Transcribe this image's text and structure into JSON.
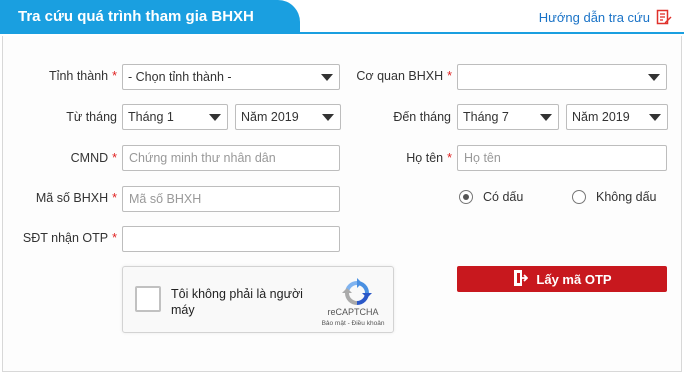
{
  "header": {
    "title": "Tra cứu quá trình tham gia BHXH",
    "guide_label": "Hướng dẫn tra cứu"
  },
  "colors": {
    "brand_blue": "#1a9fe0",
    "button_red": "#c8181e",
    "required": "#e02020"
  },
  "form": {
    "province": {
      "label": "Tỉnh thành",
      "value": "- Chọn tỉnh thành -"
    },
    "agency": {
      "label": "Cơ quan BHXH",
      "value": ""
    },
    "from": {
      "label": "Từ tháng",
      "month": "Tháng 1",
      "year": "Năm 2019"
    },
    "to": {
      "label": "Đến tháng",
      "month": "Tháng 7",
      "year": "Năm 2019"
    },
    "cmnd": {
      "label": "CMND",
      "placeholder": "Chứng minh thư nhân dân"
    },
    "name": {
      "label": "Họ tên",
      "placeholder": "Họ tên"
    },
    "bhxh": {
      "label": "Mã số BHXH",
      "placeholder": "Mã số BHXH"
    },
    "phone": {
      "label": "SĐT nhận OTP",
      "placeholder": ""
    },
    "diacritics": {
      "with_label": "Có dấu",
      "without_label": "Không dấu",
      "selected": "with"
    },
    "required_mark": "*"
  },
  "captcha": {
    "text": "Tôi không phải là người máy",
    "brand": "reCAPTCHA",
    "links": "Bảo mật - Điều khoản"
  },
  "otp_button": {
    "label": "Lấy mã OTP"
  }
}
